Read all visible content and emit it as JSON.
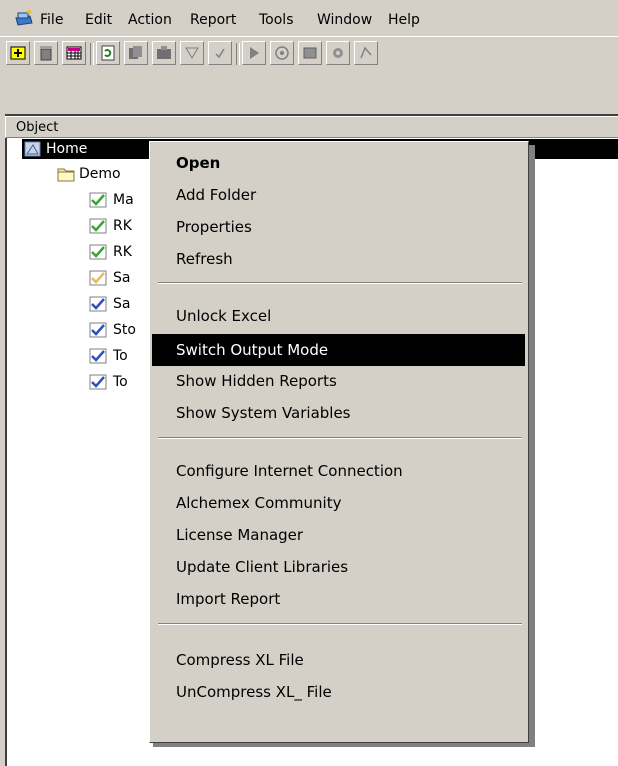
{
  "menubar": {
    "items": [
      "File",
      "Edit",
      "Action",
      "Report",
      "Tools",
      "Window",
      "Help"
    ]
  },
  "toolbar": {
    "buttons": [
      "add-folder-icon",
      "delete-icon",
      "grid-icon",
      "refresh-icon",
      "copy-icon",
      "paste-icon",
      "filter-icon",
      "check-icon",
      "run-icon",
      "options-icon",
      "window-icon",
      "settings-icon",
      "query-icon"
    ]
  },
  "tree": {
    "column_header": "Object",
    "root": {
      "label": "Home",
      "icon": "home-report-icon"
    },
    "items": [
      {
        "label": "Demo",
        "icon": "folder-icon",
        "color": "#3a6fd0"
      },
      {
        "label": "Ma",
        "icon": "report-check-icon",
        "color": "#3aa632"
      },
      {
        "label": "RK",
        "icon": "report-check-icon",
        "color": "#3aa632"
      },
      {
        "label": "RK",
        "icon": "report-check-icon",
        "color": "#3aa632"
      },
      {
        "label": "Sa",
        "icon": "report-check-icon",
        "color": "#e0c060"
      },
      {
        "label": "Sa",
        "icon": "report-check-icon",
        "color": "#3050c0"
      },
      {
        "label": "Sto",
        "icon": "report-check-icon",
        "color": "#3050c0"
      },
      {
        "label": "To",
        "icon": "report-check-icon",
        "color": "#3050c0"
      },
      {
        "label": "To",
        "icon": "report-check-icon",
        "color": "#3050c0"
      }
    ]
  },
  "context_menu": {
    "groups": [
      [
        "Open",
        "Add Folder",
        "Properties",
        "Refresh"
      ],
      [
        "Unlock Excel",
        "Switch Output Mode",
        "Show Hidden Reports",
        "Show System Variables"
      ],
      [
        "Configure Internet Connection",
        "Alchemex Community",
        "License Manager",
        "Update Client Libraries",
        "Import Report"
      ],
      [
        "Compress XL File",
        "UnCompress XL_ File"
      ]
    ],
    "default_item": "Open",
    "highlighted_item": "Switch Output Mode"
  },
  "colors": {
    "face": "#d4d0c8",
    "highlight": "#000000",
    "highlight_text": "#ffffff"
  }
}
